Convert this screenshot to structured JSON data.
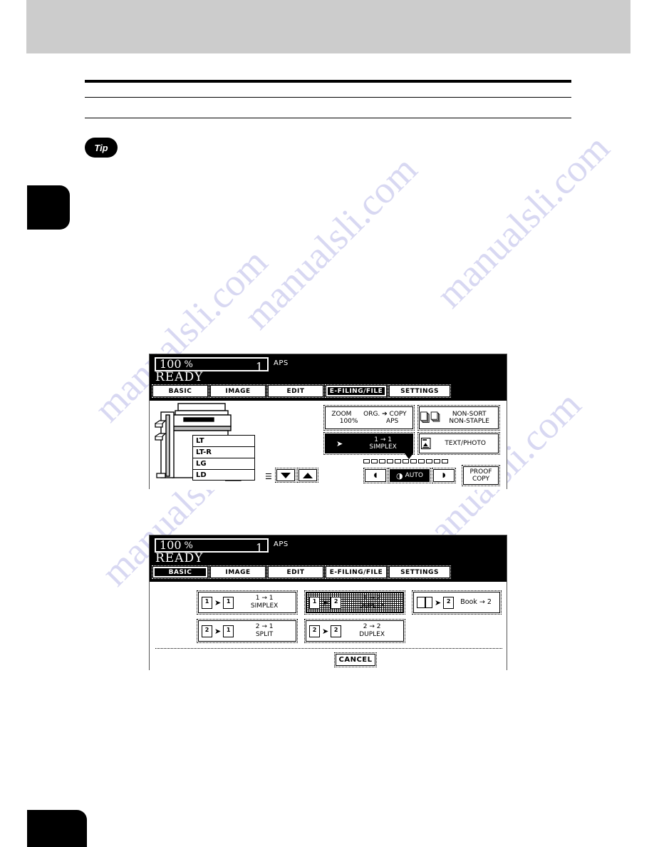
{
  "page": {
    "tip_badge": "Tip",
    "watermark_text": "manualsli.com"
  },
  "panel1": {
    "name": "copier-basic-screen",
    "status": {
      "ratio": "100",
      "ratio_unit": "%",
      "copies": "1",
      "paper_mode": "APS",
      "ready": "READY"
    },
    "tabs": [
      {
        "label": "BASIC",
        "selected": false
      },
      {
        "label": "IMAGE",
        "selected": false
      },
      {
        "label": "EDIT",
        "selected": false
      },
      {
        "label": "E-FILING/FILE",
        "selected": true
      },
      {
        "label": "SETTINGS",
        "selected": false
      }
    ],
    "drawers": [
      "LT",
      "LT-R",
      "LG",
      "LD"
    ],
    "zoom_button": {
      "zoom_label": "ZOOM",
      "zoom_value": "100%",
      "org_copy_label": "ORG. ➔ COPY",
      "aps_value": "APS"
    },
    "sort_button": {
      "line1": "NON-SORT",
      "line2": "NON-STAPLE"
    },
    "duplex_button": {
      "line1": "1 → 1",
      "line2": "SIMPLEX",
      "selected": true
    },
    "original_mode_button": {
      "label": "TEXT/PHOTO"
    },
    "exposure": {
      "left_arrow": "◖",
      "auto_label": "AUTO",
      "right_arrow": "◗",
      "steps": 11,
      "marker_step": 6
    },
    "proof_button": {
      "line1": "PROOF",
      "line2": "COPY"
    },
    "drawer_nav": {
      "down": "▼",
      "up": "▲"
    }
  },
  "panel2": {
    "name": "duplex-mode-selection-screen",
    "status": {
      "ratio": "100",
      "ratio_unit": "%",
      "copies": "1",
      "paper_mode": "APS",
      "ready": "READY"
    },
    "tabs": [
      {
        "label": "BASIC",
        "selected": true
      },
      {
        "label": "IMAGE",
        "selected": false
      },
      {
        "label": "EDIT",
        "selected": false
      },
      {
        "label": "E-FILING/FILE",
        "selected": false
      },
      {
        "label": "SETTINGS",
        "selected": false
      }
    ],
    "modes": [
      {
        "id": "simplex",
        "line1": "1 → 1",
        "line2": "SIMPLEX",
        "from": "1",
        "to": "1",
        "selected": false
      },
      {
        "id": "one-to-two-duplex",
        "line1": "1 → 2",
        "line2": "DUPLEX",
        "from": "1",
        "to": "2",
        "selected": true
      },
      {
        "id": "book-to-two",
        "label": "Book → 2",
        "from": "book",
        "to": "2",
        "selected": false
      },
      {
        "id": "split",
        "line1": "2 → 1",
        "line2": "SPLIT",
        "from": "2",
        "to": "1",
        "selected": false
      },
      {
        "id": "two-to-two-duplex",
        "line1": "2 → 2",
        "line2": "DUPLEX",
        "from": "2",
        "to": "2",
        "selected": false
      }
    ],
    "cancel_button": "CANCEL"
  }
}
